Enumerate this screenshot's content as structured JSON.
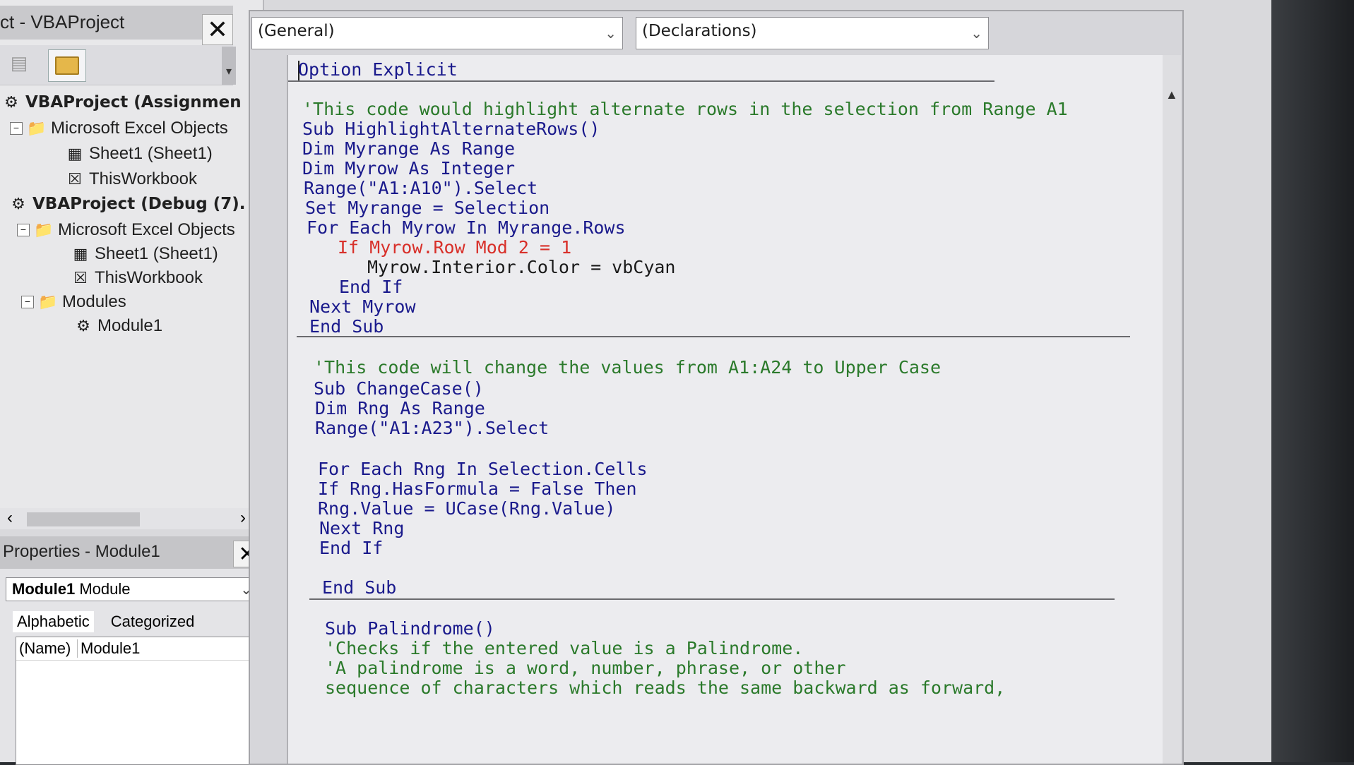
{
  "project": {
    "title": "ct - VBAProject",
    "close_label": "✕",
    "tree": [
      {
        "label": "VBAProject (Assignmen",
        "bold": true,
        "icon": "vbaproject-icon"
      },
      {
        "label": "Microsoft Excel Objects",
        "icon": "folder-icon"
      },
      {
        "label": "Sheet1 (Sheet1)",
        "icon": "sheet-icon"
      },
      {
        "label": "ThisWorkbook",
        "icon": "workbook-icon"
      },
      {
        "label": "VBAProject (Debug (7).",
        "bold": true,
        "icon": "vbaproject-icon"
      },
      {
        "label": "Microsoft Excel Objects",
        "icon": "folder-icon"
      },
      {
        "label": "Sheet1 (Sheet1)",
        "icon": "sheet-icon"
      },
      {
        "label": "ThisWorkbook",
        "icon": "workbook-icon"
      },
      {
        "label": "Modules",
        "icon": "folder-icon"
      },
      {
        "label": "Module1",
        "icon": "module-icon"
      }
    ]
  },
  "properties": {
    "title": "Properties - Module1",
    "close_label": "✕",
    "object_name": "Module1",
    "object_type": "Module",
    "tabs": [
      "Alphabetic",
      "Categorized"
    ],
    "rows": [
      {
        "key": "(Name)",
        "value": "Module1"
      }
    ]
  },
  "code": {
    "general_combo": "(General)",
    "declarations_combo": "(Declarations)",
    "lines": [
      "Option Explicit",
      "'This code would highlight alternate rows in the selection from Range A1",
      "Sub HighlightAlternateRows()",
      "Dim Myrange As Range",
      "Dim Myrow As Integer",
      "Range(\"A1:A10\").Select",
      "Set Myrange = Selection",
      "For Each Myrow In Myrange.Rows",
      "If Myrow.Row Mod 2 = 1",
      "Myrow.Interior.Color = vbCyan",
      "End If",
      "Next Myrow",
      "End Sub",
      "'This code will change the values from A1:A24 to Upper Case",
      "Sub ChangeCase()",
      "Dim Rng As Range",
      "Range(\"A1:A23\").Select",
      "For Each Rng In Selection.Cells",
      "If Rng.HasFormula = False Then",
      "Rng.Value = UCase(Rng.Value)",
      "Next Rng",
      "End If",
      "End Sub",
      "Sub Palindrome()",
      "'Checks if the entered value is a Palindrome.",
      "'A palindrome is a word, number, phrase, or other",
      "sequence of characters which reads the same backward as forward,"
    ]
  },
  "colors": {
    "keyword": "#1a1a8c",
    "comment": "#2b7a2b",
    "syntax_error": "#d8302a"
  }
}
